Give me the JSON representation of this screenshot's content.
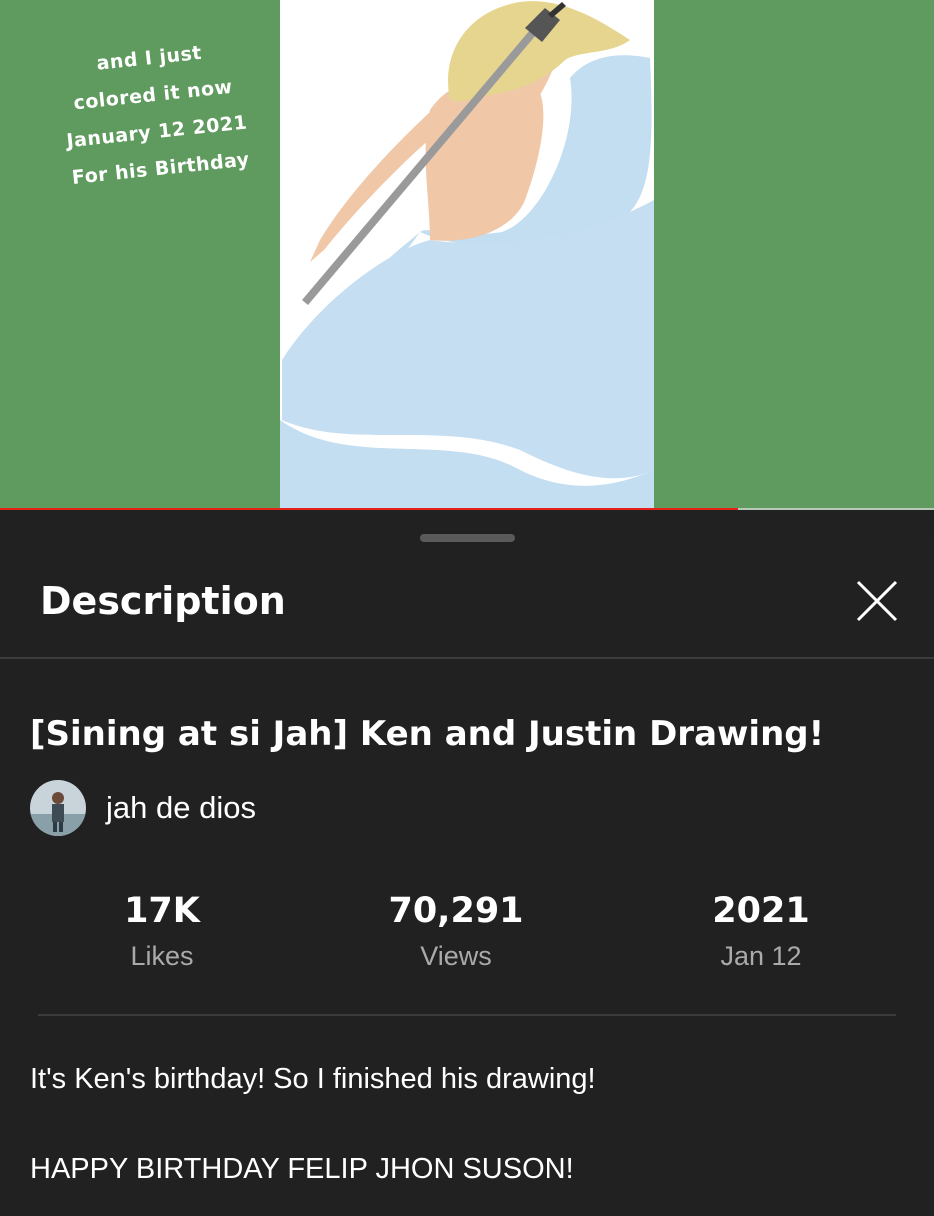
{
  "video": {
    "overlay_text": [
      "and I just",
      "colored it now",
      "January 12 2021",
      "For his Birthday"
    ],
    "progress_fraction": 0.79,
    "progress_color": "#e62117",
    "background_color": "#5f9a5f"
  },
  "panel": {
    "title": "Description",
    "close_icon": "close-icon"
  },
  "details": {
    "title": "[Sining at si Jah] Ken and Justin Drawing!",
    "channel_name": "jah de dios",
    "stats": [
      {
        "value": "17K",
        "label": "Likes"
      },
      {
        "value": "70,291",
        "label": "Views"
      },
      {
        "value": "2021",
        "label": "Jan 12"
      }
    ],
    "description": [
      "It's Ken's birthday! So I finished his drawing!",
      "HAPPY BIRTHDAY FELIP JHON SUSON!"
    ]
  }
}
